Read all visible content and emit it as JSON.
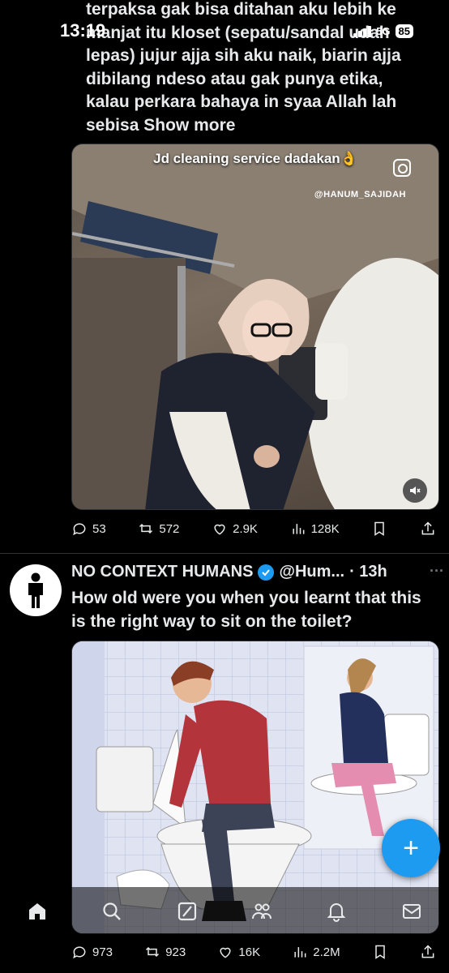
{
  "status_bar": {
    "time": "13:19",
    "network": "5G",
    "battery": "85"
  },
  "tweet1": {
    "text_lines": [
      "terpaksa gak bisa ditahan aku lebih ke",
      "manjat itu kloset (sepatu/sandal udah",
      "lepas) jujur ajja sih aku naik, biarin ajja",
      "dibilang ndeso atau gak punya etika,",
      "kalau perkara bahaya in syaa Allah lah",
      "sebisa"
    ],
    "show_more": "Show more",
    "media": {
      "caption": "Jd cleaning service dadakan👌",
      "handle": "@HANUM_SAJIDAH",
      "icons": {
        "instagram": "instagram-icon",
        "mute": "mute-icon"
      }
    },
    "stats": {
      "replies": "53",
      "reposts": "572",
      "likes": "2.9K",
      "views": "128K"
    }
  },
  "tweet2": {
    "author_name": "NO CONTEXT HUMANS",
    "author_handle": "@Hum...",
    "time": "· 13h",
    "more": "···",
    "text_line1": "How old were you when you learnt that this",
    "text_line2": "is the right way to sit on the toilet?",
    "stats": {
      "replies": "973",
      "reposts": "923",
      "likes": "16K",
      "views": "2.2M"
    }
  },
  "fab": {
    "label": "+"
  },
  "bottom_nav": [
    "home-icon",
    "search-icon",
    "grok-icon",
    "communities-icon",
    "notifications-icon",
    "messages-icon"
  ],
  "colors": {
    "background": "#000000",
    "accent": "#1d9bf0",
    "text": "#e7e9ea",
    "muted": "#71767b",
    "divider": "#2f3336"
  }
}
